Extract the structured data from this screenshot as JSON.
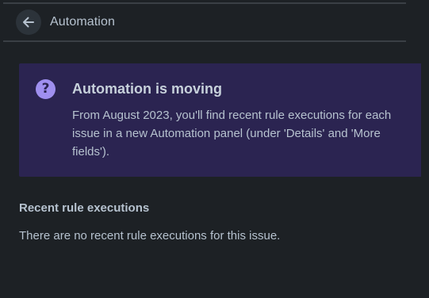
{
  "header": {
    "title": "Automation",
    "back_icon": "arrow-left-icon"
  },
  "banner": {
    "icon": "question-circle-icon",
    "title": "Automation is moving",
    "body": "From August 2023, you'll find recent rule executions for each issue in a new Automation panel (under 'Details' and 'More fields')."
  },
  "recent": {
    "title": "Recent rule executions",
    "empty_message": "There are no recent rule executions for this issue."
  },
  "colors": {
    "background": "#1d2125",
    "banner_background": "#2b2451",
    "banner_icon": "#9f8fef",
    "text": "#b6c2cf"
  }
}
